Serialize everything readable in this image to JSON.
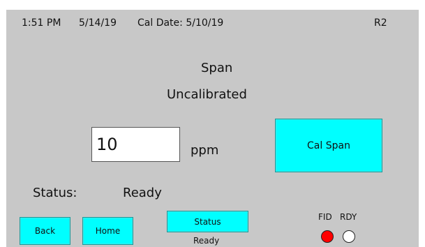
{
  "header": {
    "time": "1:51 PM",
    "date": "5/14/19",
    "cal_date": "Cal Date: 5/10/19",
    "revision": "R2"
  },
  "main": {
    "mode": "Span",
    "cal_status": "Uncalibrated",
    "concentration_value": "10",
    "unit": "ppm",
    "cal_span_button": "Cal Span"
  },
  "status": {
    "label": "Status:",
    "value": "Ready"
  },
  "footer": {
    "back_button": "Back",
    "home_button": "Home",
    "status_button": "Status",
    "status_sub": "Ready",
    "indicator_fid_label": "FID",
    "indicator_rdy_label": "RDY",
    "fid_color": "#ff0000",
    "rdy_color": "#ffffff",
    "accent_color": "#00ffff"
  }
}
